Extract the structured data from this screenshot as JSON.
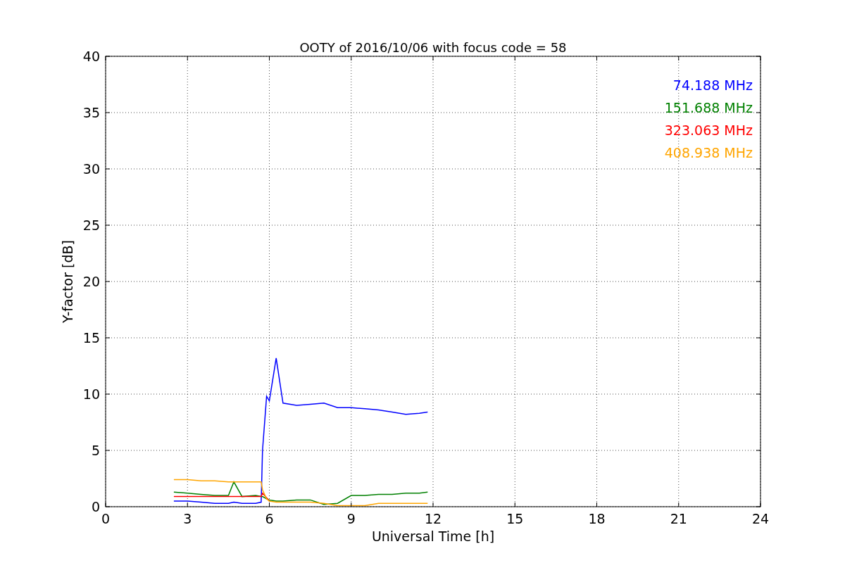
{
  "chart_data": {
    "type": "line",
    "title": "OOTY of 2016/10/06 with focus code = 58",
    "xlabel": "Universal Time [h]",
    "ylabel": "Y-factor [dB]",
    "x": [
      2.5,
      3,
      3.5,
      4,
      4.5,
      4.7,
      5,
      5.5,
      5.7,
      5.75,
      5.9,
      6,
      6.25,
      6.5,
      7,
      7.5,
      8,
      8.5,
      9,
      9.5,
      10,
      10.5,
      11,
      11.5,
      11.8
    ],
    "series": [
      {
        "name": "74.188 MHz",
        "color": "#0000ff",
        "values": [
          0.5,
          0.5,
          0.4,
          0.3,
          0.3,
          0.4,
          0.3,
          0.3,
          0.4,
          5.0,
          9.8,
          9.4,
          13.2,
          9.2,
          9.0,
          9.1,
          9.2,
          8.8,
          8.8,
          8.7,
          8.6,
          8.4,
          8.2,
          8.3,
          8.4
        ]
      },
      {
        "name": "151.688 MHz",
        "color": "#008000",
        "values": [
          1.3,
          1.2,
          1.1,
          1.0,
          1.0,
          2.2,
          0.9,
          1.0,
          0.9,
          0.9,
          0.7,
          0.6,
          0.5,
          0.5,
          0.6,
          0.6,
          0.2,
          0.3,
          1.0,
          1.0,
          1.1,
          1.1,
          1.2,
          1.2,
          1.3
        ]
      },
      {
        "name": "323.063 MHz",
        "color": "#ff0000",
        "values": [
          0.9,
          0.9,
          0.9,
          0.9,
          0.9,
          0.9,
          0.9,
          0.9,
          0.9,
          1.2,
          0.8,
          0.5,
          null,
          null,
          null,
          null,
          null,
          null,
          null,
          null,
          null,
          null,
          null,
          null,
          null
        ]
      },
      {
        "name": "408.938 MHz",
        "color": "#ffa500",
        "values": [
          2.4,
          2.4,
          2.3,
          2.3,
          2.2,
          2.2,
          2.2,
          2.2,
          2.2,
          1.5,
          0.7,
          0.5,
          0.4,
          0.4,
          0.4,
          0.4,
          0.3,
          0.1,
          0.1,
          0.1,
          0.3,
          0.3,
          0.3,
          0.3,
          0.3
        ]
      }
    ],
    "grid": true,
    "xlim": [
      0,
      24
    ],
    "ylim": [
      0,
      40
    ],
    "xticks": [
      0,
      3,
      6,
      9,
      12,
      15,
      18,
      21,
      24
    ],
    "yticks": [
      0,
      5,
      10,
      15,
      20,
      25,
      30,
      35,
      40
    ]
  }
}
